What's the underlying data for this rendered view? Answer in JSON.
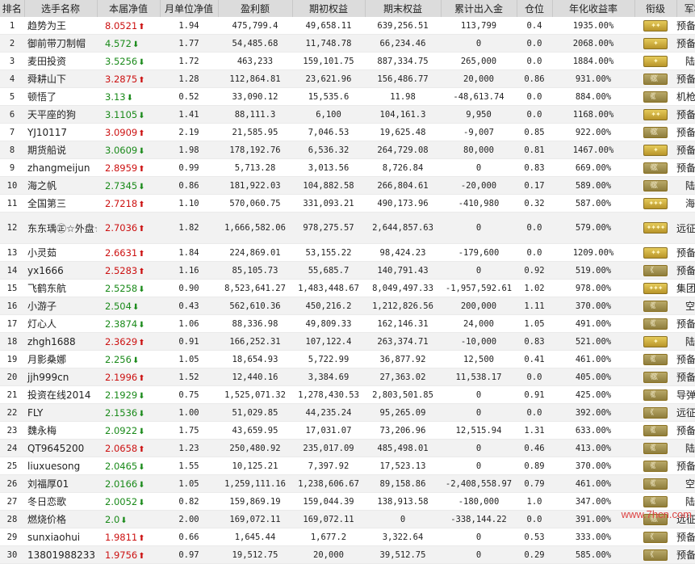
{
  "headers": [
    "排名",
    "选手名称",
    "本届净值",
    "月单位净值",
    "盈利额",
    "期初权益",
    "期末权益",
    "累计出入金",
    "仓位",
    "年化收益率",
    "衔级",
    "军种"
  ],
  "rows": [
    {
      "rank": "1",
      "name": "趋势为王",
      "nav": "8.0521",
      "dir": "up",
      "unit": "1.94",
      "profit": "475,799.4",
      "start": "49,658.11",
      "end": "639,256.51",
      "flow": "113,799",
      "pos": "0.4",
      "annual": "1935.00%",
      "badge": "gold",
      "marks": "✦✦",
      "branch": "预备役"
    },
    {
      "rank": "2",
      "name": "御前带刀制帽",
      "nav": "4.572",
      "dir": "down",
      "unit": "1.77",
      "profit": "54,485.68",
      "start": "11,748.78",
      "end": "66,234.46",
      "flow": "0",
      "pos": "0.0",
      "annual": "2068.00%",
      "badge": "gold",
      "marks": "✦",
      "branch": "预备役"
    },
    {
      "rank": "3",
      "name": "麦田投资",
      "nav": "3.5256",
      "dir": "down",
      "unit": "1.72",
      "profit": "463,233",
      "start": "159,101.75",
      "end": "887,334.75",
      "flow": "265,000",
      "pos": "0.0",
      "annual": "1884.00%",
      "badge": "gold",
      "marks": "✦",
      "branch": "陆军"
    },
    {
      "rank": "4",
      "name": "舜耕山下",
      "nav": "3.2875",
      "dir": "up",
      "unit": "1.28",
      "profit": "112,864.81",
      "start": "23,621.96",
      "end": "156,486.77",
      "flow": "20,000",
      "pos": "0.86",
      "annual": "931.00%",
      "badge": "olive",
      "marks": "《《《",
      "branch": "预备役"
    },
    {
      "rank": "5",
      "name": "顿悟了",
      "nav": "3.13",
      "dir": "down",
      "unit": "0.52",
      "profit": "33,090.12",
      "start": "15,535.6",
      "end": "11.98",
      "flow": "-48,613.74",
      "pos": "0.0",
      "annual": "884.00%",
      "badge": "olive",
      "marks": "《《",
      "branch": "机枪手"
    },
    {
      "rank": "6",
      "name": "天平座的狗",
      "nav": "3.1105",
      "dir": "down",
      "unit": "1.41",
      "profit": "88,111.3",
      "start": "6,100",
      "end": "104,161.3",
      "flow": "9,950",
      "pos": "0.0",
      "annual": "1168.00%",
      "badge": "gold",
      "marks": "✦✦",
      "branch": "预备役"
    },
    {
      "rank": "7",
      "name": "YJ10117",
      "nav": "3.0909",
      "dir": "up",
      "unit": "2.19",
      "profit": "21,585.95",
      "start": "7,046.53",
      "end": "19,625.48",
      "flow": "-9,007",
      "pos": "0.85",
      "annual": "922.00%",
      "badge": "olive",
      "marks": "《《《",
      "branch": "预备役"
    },
    {
      "rank": "8",
      "name": "期货船说",
      "nav": "3.0609",
      "dir": "down",
      "unit": "1.98",
      "profit": "178,192.76",
      "start": "6,536.32",
      "end": "264,729.08",
      "flow": "80,000",
      "pos": "0.81",
      "annual": "1467.00%",
      "badge": "gold",
      "marks": "✦",
      "branch": "预备役"
    },
    {
      "rank": "9",
      "name": "zhangmeijun",
      "nav": "2.8959",
      "dir": "up",
      "unit": "0.99",
      "profit": "5,713.28",
      "start": "3,013.56",
      "end": "8,726.84",
      "flow": "0",
      "pos": "0.83",
      "annual": "669.00%",
      "badge": "olive",
      "marks": "《《《",
      "branch": "预备役"
    },
    {
      "rank": "10",
      "name": "海之帆",
      "nav": "2.7345",
      "dir": "down",
      "unit": "0.86",
      "profit": "181,922.03",
      "start": "104,882.58",
      "end": "266,804.61",
      "flow": "-20,000",
      "pos": "0.17",
      "annual": "589.00%",
      "badge": "olive",
      "marks": "《《《",
      "branch": "陆军"
    },
    {
      "rank": "11",
      "name": "全国第三",
      "nav": "2.7218",
      "dir": "up",
      "unit": "1.10",
      "profit": "570,060.75",
      "start": "331,093.21",
      "end": "490,173.96",
      "flow": "-410,980",
      "pos": "0.32",
      "annual": "587.00%",
      "badge": "gold",
      "marks": "✦✦✦",
      "branch": "海军"
    },
    {
      "rank": "12",
      "name": "东东瑀㊣☆外盘☆",
      "nav": "2.7036",
      "dir": "up",
      "unit": "1.82",
      "profit": "1,666,582.06",
      "start": "978,275.57",
      "end": "2,644,857.63",
      "flow": "0",
      "pos": "0.0",
      "annual": "579.00%",
      "badge": "gold",
      "marks": "✦✦✦✦",
      "branch": "远征军",
      "tall": true
    },
    {
      "rank": "13",
      "name": "小灵茹",
      "nav": "2.6631",
      "dir": "up",
      "unit": "1.84",
      "profit": "224,869.01",
      "start": "53,155.22",
      "end": "98,424.23",
      "flow": "-179,600",
      "pos": "0.0",
      "annual": "1209.00%",
      "badge": "gold",
      "marks": "✦✦",
      "branch": "预备役"
    },
    {
      "rank": "14",
      "name": "yx1666",
      "nav": "2.5283",
      "dir": "up",
      "unit": "1.16",
      "profit": "85,105.73",
      "start": "55,685.7",
      "end": "140,791.43",
      "flow": "0",
      "pos": "0.92",
      "annual": "519.00%",
      "badge": "olive",
      "marks": "《",
      "branch": "预备役"
    },
    {
      "rank": "15",
      "name": "飞鹤东航",
      "nav": "2.5258",
      "dir": "down",
      "unit": "0.90",
      "profit": "8,523,641.27",
      "start": "1,483,448.67",
      "end": "8,049,497.33",
      "flow": "-1,957,592.61",
      "pos": "1.02",
      "annual": "978.00%",
      "badge": "gold",
      "marks": "✦✦✦",
      "branch": "集团军"
    },
    {
      "rank": "16",
      "name": "小游子",
      "nav": "2.504",
      "dir": "down",
      "unit": "0.43",
      "profit": "562,610.36",
      "start": "450,216.2",
      "end": "1,212,826.56",
      "flow": "200,000",
      "pos": "1.11",
      "annual": "370.00%",
      "badge": "olive",
      "marks": "《《",
      "branch": "空军"
    },
    {
      "rank": "17",
      "name": "灯心人",
      "nav": "2.3874",
      "dir": "down",
      "unit": "1.06",
      "profit": "88,336.98",
      "start": "49,809.33",
      "end": "162,146.31",
      "flow": "24,000",
      "pos": "1.05",
      "annual": "491.00%",
      "badge": "olive",
      "marks": "《《",
      "branch": "预备役"
    },
    {
      "rank": "18",
      "name": "zhgh1688",
      "nav": "2.3629",
      "dir": "up",
      "unit": "0.91",
      "profit": "166,252.31",
      "start": "107,122.4",
      "end": "263,374.71",
      "flow": "-10,000",
      "pos": "0.83",
      "annual": "521.00%",
      "badge": "gold",
      "marks": "✦",
      "branch": "陆军"
    },
    {
      "rank": "19",
      "name": "月影桑娜",
      "nav": "2.256",
      "dir": "down",
      "unit": "1.05",
      "profit": "18,654.93",
      "start": "5,722.99",
      "end": "36,877.92",
      "flow": "12,500",
      "pos": "0.41",
      "annual": "461.00%",
      "badge": "olive",
      "marks": "《《",
      "branch": "预备役"
    },
    {
      "rank": "20",
      "name": "jjh999cn",
      "nav": "2.1996",
      "dir": "up",
      "unit": "1.52",
      "profit": "12,440.16",
      "start": "3,384.69",
      "end": "27,363.02",
      "flow": "11,538.17",
      "pos": "0.0",
      "annual": "405.00%",
      "badge": "olive",
      "marks": "《《《",
      "branch": "预备役"
    },
    {
      "rank": "21",
      "name": "投资在线2014",
      "nav": "2.1929",
      "dir": "down",
      "unit": "0.75",
      "profit": "1,525,071.32",
      "start": "1,278,430.53",
      "end": "2,803,501.85",
      "flow": "0",
      "pos": "0.91",
      "annual": "425.00%",
      "badge": "olive",
      "marks": "《《",
      "branch": "导弹部"
    },
    {
      "rank": "22",
      "name": "FLY",
      "nav": "2.1536",
      "dir": "down",
      "unit": "1.00",
      "profit": "51,029.85",
      "start": "44,235.24",
      "end": "95,265.09",
      "flow": "0",
      "pos": "0.0",
      "annual": "392.00%",
      "badge": "olive",
      "marks": "《",
      "branch": "远征军"
    },
    {
      "rank": "23",
      "name": "魏永梅",
      "nav": "2.0922",
      "dir": "down",
      "unit": "1.75",
      "profit": "43,659.95",
      "start": "17,031.07",
      "end": "73,206.96",
      "flow": "12,515.94",
      "pos": "1.31",
      "annual": "633.00%",
      "badge": "olive",
      "marks": "《《",
      "branch": "预备役"
    },
    {
      "rank": "24",
      "name": "QT9645200",
      "nav": "2.0658",
      "dir": "up",
      "unit": "1.23",
      "profit": "250,480.92",
      "start": "235,017.09",
      "end": "485,498.01",
      "flow": "0",
      "pos": "0.46",
      "annual": "413.00%",
      "badge": "olive",
      "marks": "《《",
      "branch": "陆军"
    },
    {
      "rank": "25",
      "name": "liuxuesong",
      "nav": "2.0465",
      "dir": "down",
      "unit": "1.55",
      "profit": "10,125.21",
      "start": "7,397.92",
      "end": "17,523.13",
      "flow": "0",
      "pos": "0.89",
      "annual": "370.00%",
      "badge": "olive",
      "marks": "《《",
      "branch": "预备役"
    },
    {
      "rank": "26",
      "name": "刘福厚01",
      "nav": "2.0166",
      "dir": "down",
      "unit": "1.05",
      "profit": "1,259,111.16",
      "start": "1,238,606.67",
      "end": "89,158.86",
      "flow": "-2,408,558.97",
      "pos": "0.79",
      "annual": "461.00%",
      "badge": "olive",
      "marks": "《《",
      "branch": "空军"
    },
    {
      "rank": "27",
      "name": "冬日恋歌",
      "nav": "2.0052",
      "dir": "down",
      "unit": "0.82",
      "profit": "159,869.19",
      "start": "159,044.39",
      "end": "138,913.58",
      "flow": "-180,000",
      "pos": "1.0",
      "annual": "347.00%",
      "badge": "olive",
      "marks": "《《",
      "branch": "陆军"
    },
    {
      "rank": "28",
      "name": "燃烧价格",
      "nav": "2.0",
      "dir": "down",
      "unit": "2.00",
      "profit": "169,072.11",
      "start": "169,072.11",
      "end": "0",
      "flow": "-338,144.22",
      "pos": "0.0",
      "annual": "391.00%",
      "badge": "olive",
      "marks": "《《《",
      "branch": "远征军"
    },
    {
      "rank": "29",
      "name": "sunxiaohui",
      "nav": "1.9811",
      "dir": "up",
      "unit": "0.66",
      "profit": "1,645.44",
      "start": "1,677.2",
      "end": "3,322.64",
      "flow": "0",
      "pos": "0.53",
      "annual": "333.00%",
      "badge": "olive",
      "marks": "《",
      "branch": "预备役"
    },
    {
      "rank": "30",
      "name": "13801988233",
      "nav": "1.9756",
      "dir": "up",
      "unit": "0.97",
      "profit": "19,512.75",
      "start": "20,000",
      "end": "39,512.75",
      "flow": "0",
      "pos": "0.29",
      "annual": "585.00%",
      "badge": "olive",
      "marks": "《",
      "branch": "预备役"
    }
  ],
  "arrows": {
    "up": "⬆",
    "down": "⬇"
  },
  "watermark": "www.7hcn.com"
}
